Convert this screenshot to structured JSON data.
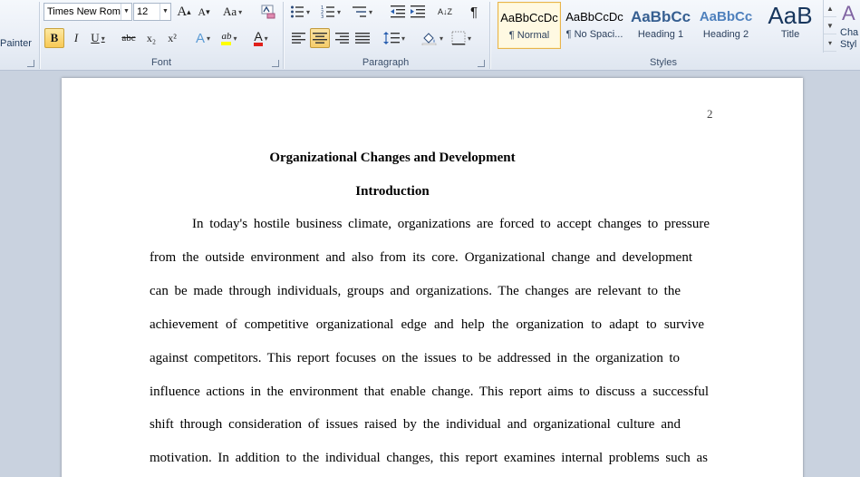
{
  "ribbon": {
    "clipboard": {
      "format_painter_label": "Painter"
    },
    "font": {
      "group_label": "Font",
      "font_name": "Times New Rom",
      "font_size": "12",
      "grow_font": "A",
      "shrink_font": "A",
      "change_case": "Aa",
      "bold": "B",
      "italic": "I",
      "underline": "U",
      "strikethrough": "abc",
      "subscript": "x₂",
      "superscript": "x²",
      "text_effects": "A",
      "highlight": "ab",
      "font_color": "A"
    },
    "paragraph": {
      "group_label": "Paragraph",
      "sort": "A↓Z",
      "pilcrow": "¶"
    },
    "styles": {
      "group_label": "Styles",
      "items": [
        {
          "sample": "AaBbCcDc",
          "name": "¶ Normal"
        },
        {
          "sample": "AaBbCcDc",
          "name": "¶ No Spaci..."
        },
        {
          "sample": "AaBbCc",
          "name": "Heading 1"
        },
        {
          "sample": "AaBbCc",
          "name": "Heading 2"
        },
        {
          "sample": "AaB",
          "name": "Title"
        }
      ],
      "change_styles_label_1": "Cha",
      "change_styles_label_2": "Styl"
    },
    "colors": {
      "highlight": "#ffff00",
      "font_color": "#e0201b",
      "accent": "#e8b44d",
      "heading": "#4f81bd"
    }
  },
  "document": {
    "page_number": "2",
    "title": "Organizational Changes and Development",
    "heading": "Introduction",
    "lines": [
      "In today's hostile business climate, organizations are forced to accept changes to pressure",
      "from the outside environment and also from its core. Organizational change and development",
      "can be made through individuals, groups and organizations. The changes are relevant to the",
      "achievement of competitive organizational edge and help the organization to adapt to survive",
      "against competitors. This report focuses on the issues to be addressed in the organization to",
      "influence actions in the environment that enable change. This report aims to discuss a successful",
      "shift through consideration of issues raised by the individual and organizational culture and",
      "motivation. In addition to the individual changes, this report examines internal problems such as"
    ]
  }
}
